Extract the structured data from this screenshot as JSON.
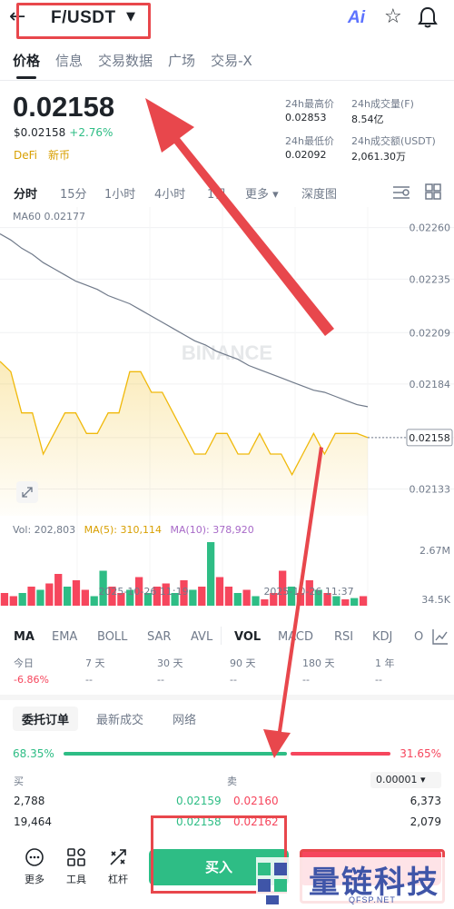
{
  "header": {
    "back_icon": "back-arrow-icon",
    "pair": "F/USDT",
    "ai_label": "Ai",
    "icons": [
      "star-icon",
      "bell-icon"
    ]
  },
  "tabs": [
    "价格",
    "信息",
    "交易数据",
    "广场",
    "交易-X"
  ],
  "ticker": {
    "price": "0.02158",
    "usd_price": "$0.02158",
    "change": "+2.76%",
    "tags": [
      "DeFi",
      "新币"
    ],
    "stats": [
      {
        "label": "24h最高价",
        "value": "0.02853"
      },
      {
        "label": "24h成交量(F)",
        "value": "8.54亿"
      },
      {
        "label": "24h最低价",
        "value": "0.02092"
      },
      {
        "label": "24h成交额(USDT)",
        "value": "2,061.30万"
      }
    ]
  },
  "intervals": [
    "分时",
    "15分",
    "1小时",
    "4小时",
    "1日",
    "更多 ▾",
    "深度图"
  ],
  "chart_data": {
    "type": "line",
    "ma60_label": "MA60 0.02177",
    "y_ticks": [
      "0.02260",
      "0.02235",
      "0.02209",
      "0.02184",
      "0.02158",
      "0.02133"
    ],
    "current_price_label": "0.02158",
    "x_labels": [
      "2025-10-26 11:19",
      "2025-10-26 11:37"
    ],
    "watermark": "BINANCE",
    "series": [
      {
        "values": [
          0.02195,
          0.0219,
          0.0217,
          0.0217,
          0.0215,
          0.0216,
          0.0217,
          0.0217,
          0.0216,
          0.0216,
          0.0217,
          0.0217,
          0.0219,
          0.0219,
          0.0218,
          0.0218,
          0.0217,
          0.0216,
          0.0215,
          0.0215,
          0.0216,
          0.0216,
          0.0215,
          0.0215,
          0.0216,
          0.0215,
          0.0215,
          0.0214,
          0.0215,
          0.0216,
          0.0215,
          0.0216,
          0.0216,
          0.0216,
          0.02158
        ]
      },
      {
        "values": [
          0.02257,
          0.02254,
          0.0225,
          0.02247,
          0.02243,
          0.0224,
          0.02237,
          0.02234,
          0.02232,
          0.0223,
          0.02227,
          0.02225,
          0.02223,
          0.0222,
          0.02217,
          0.02214,
          0.02211,
          0.02208,
          0.02205,
          0.02203,
          0.022,
          0.02198,
          0.02196,
          0.02193,
          0.02191,
          0.02189,
          0.02187,
          0.02185,
          0.02183,
          0.02181,
          0.0218,
          0.02178,
          0.02176,
          0.02174,
          0.02173
        ]
      }
    ],
    "volume": {
      "label": "Vol: 202,803",
      "ma5": "MA(5): 310,114",
      "ma10": "MA(10): 378,920",
      "y_ticks": [
        "2.67M",
        "34.5K"
      ],
      "bars": [
        0.2,
        0.15,
        0.2,
        0.3,
        0.25,
        0.35,
        0.5,
        0.3,
        0.4,
        0.25,
        0.15,
        0.55,
        0.3,
        0.2,
        0.25,
        0.45,
        0.2,
        0.3,
        0.35,
        0.2,
        0.4,
        0.25,
        0.3,
        1.0,
        0.45,
        0.3,
        0.2,
        0.25,
        0.15,
        0.1,
        0.2,
        0.55,
        0.3,
        0.2,
        0.4,
        0.25,
        0.2,
        0.15,
        0.1,
        0.12,
        0.15
      ],
      "up": [
        false,
        false,
        true,
        false,
        true,
        false,
        false,
        true,
        false,
        false,
        true,
        true,
        false,
        false,
        true,
        false,
        true,
        false,
        false,
        true,
        false,
        true,
        false,
        true,
        false,
        false,
        true,
        false,
        true,
        false,
        false,
        false,
        true,
        false,
        false,
        true,
        false,
        true,
        false,
        true,
        false
      ]
    }
  },
  "indicators": [
    "MA",
    "EMA",
    "BOLL",
    "SAR",
    "AVL",
    "VOL",
    "MACD",
    "RSI",
    "KDJ",
    "O"
  ],
  "performance": [
    {
      "label": "今日",
      "value": "-6.86%"
    },
    {
      "label": "7 天",
      "value": "--"
    },
    {
      "label": "30 天",
      "value": "--"
    },
    {
      "label": "90 天",
      "value": "--"
    },
    {
      "label": "180 天",
      "value": "--"
    },
    {
      "label": "1 年",
      "value": "--"
    }
  ],
  "orderbook": {
    "tabs": [
      "委托订单",
      "最新成交",
      "网络"
    ],
    "buy_ratio": "68.35%",
    "sell_ratio": "31.65%",
    "buy_fraction": 0.6835,
    "buy_header": "买",
    "sell_header": "卖",
    "precision": "0.00001 ▾",
    "rows": [
      {
        "bid_qty": "2,788",
        "bid": "0.02159",
        "ask": "0.02160",
        "ask_qty": "6,373"
      },
      {
        "bid_qty": "19,464",
        "bid": "0.02158",
        "ask": "0.02162",
        "ask_qty": "2,079"
      }
    ]
  },
  "bottom": {
    "items": [
      {
        "icon": "more-icon",
        "label": "更多"
      },
      {
        "icon": "tools-icon",
        "label": "工具"
      },
      {
        "icon": "leverage-icon",
        "label": "杠杆"
      }
    ],
    "buy_label": "买入"
  },
  "watermark": {
    "text": "量链科技",
    "sub": "QFSP.NET"
  },
  "colors": {
    "up": "#2ebd85",
    "down": "#f6465d",
    "accent": "#d89f00",
    "annotation": "#e8474c"
  }
}
